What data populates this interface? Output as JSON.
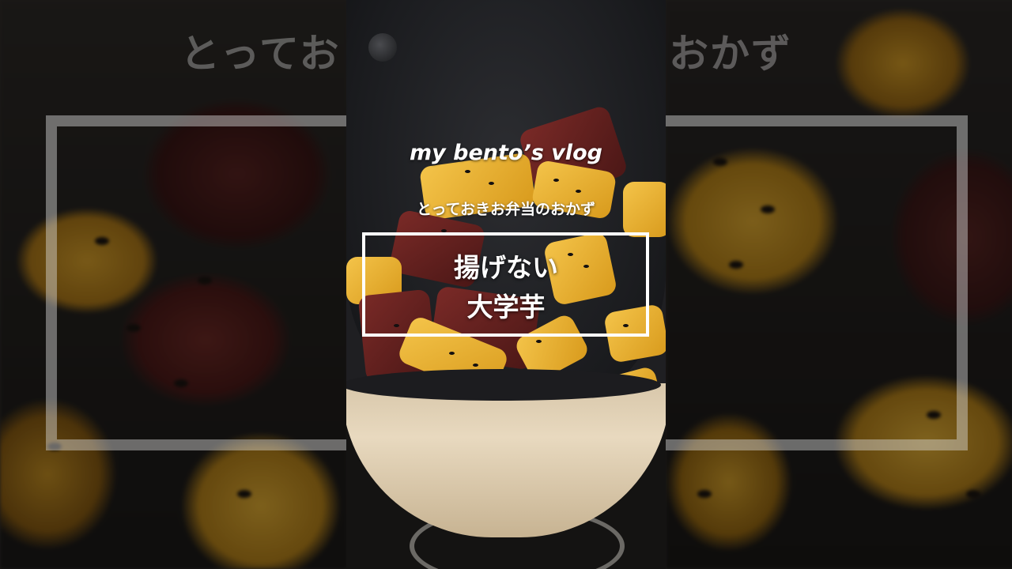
{
  "video": {
    "channel_title": "my bento’s vlog",
    "subtitle": "とっておきお弁当のおかず",
    "title_line1": "揚げない",
    "title_line2": "大学芋"
  },
  "background_blur": {
    "left_text": "とってお",
    "right_text": "おかず"
  }
}
